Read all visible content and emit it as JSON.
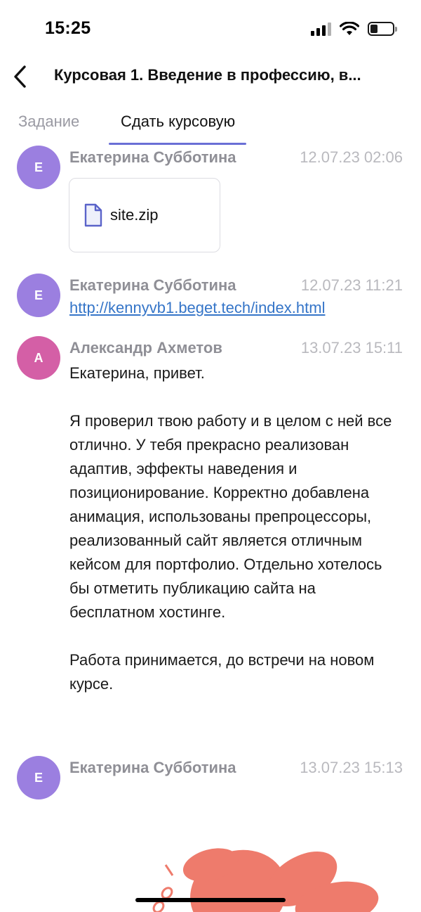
{
  "status_bar": {
    "time": "15:25",
    "icons": [
      "signal-icon",
      "wifi-icon",
      "battery-icon"
    ]
  },
  "header": {
    "back_icon": "chevron-left-icon",
    "title": "Курсовая 1. Введение в профессию, в..."
  },
  "tabs": [
    {
      "label": "Задание",
      "active": false
    },
    {
      "label": "Сдать курсовую",
      "active": true
    }
  ],
  "colors": {
    "accent": "#6a6fd6",
    "avatar_purple": "#9b7fe0",
    "avatar_pink": "#d45fa6",
    "link": "#3575c8",
    "decor": "#ee7b6c"
  },
  "messages": [
    {
      "avatar_letter": "E",
      "author": "Екатерина Субботина",
      "time": "12.07.23 02:06",
      "attachment": {
        "icon": "file-icon",
        "name": "site.zip"
      }
    },
    {
      "avatar_letter": "E",
      "author": "Екатерина Субботина",
      "time": "12.07.23 11:21",
      "link": "http://kennyvb1.beget.tech/index.html"
    },
    {
      "avatar_letter": "A",
      "author": "Александр Ахметов",
      "time": "13.07.23 15:11",
      "text": "Екатерина, привет.\n\nЯ проверил твою работу и в целом с ней все отлично. У тебя прекрасно реализован адаптив, эффекты наведения и позиционирование. Корректно добавлена анимация, использованы препроцессоры, реализованный сайт является отличным кейсом для портфолио. Отдельно хотелось бы отметить публикацию сайта на бесплатном хостинге.\n\nРабота принимается, до встречи на новом курсе."
    },
    {
      "avatar_letter": "E",
      "author": "Екатерина Субботина",
      "time": "13.07.23 15:13"
    }
  ]
}
